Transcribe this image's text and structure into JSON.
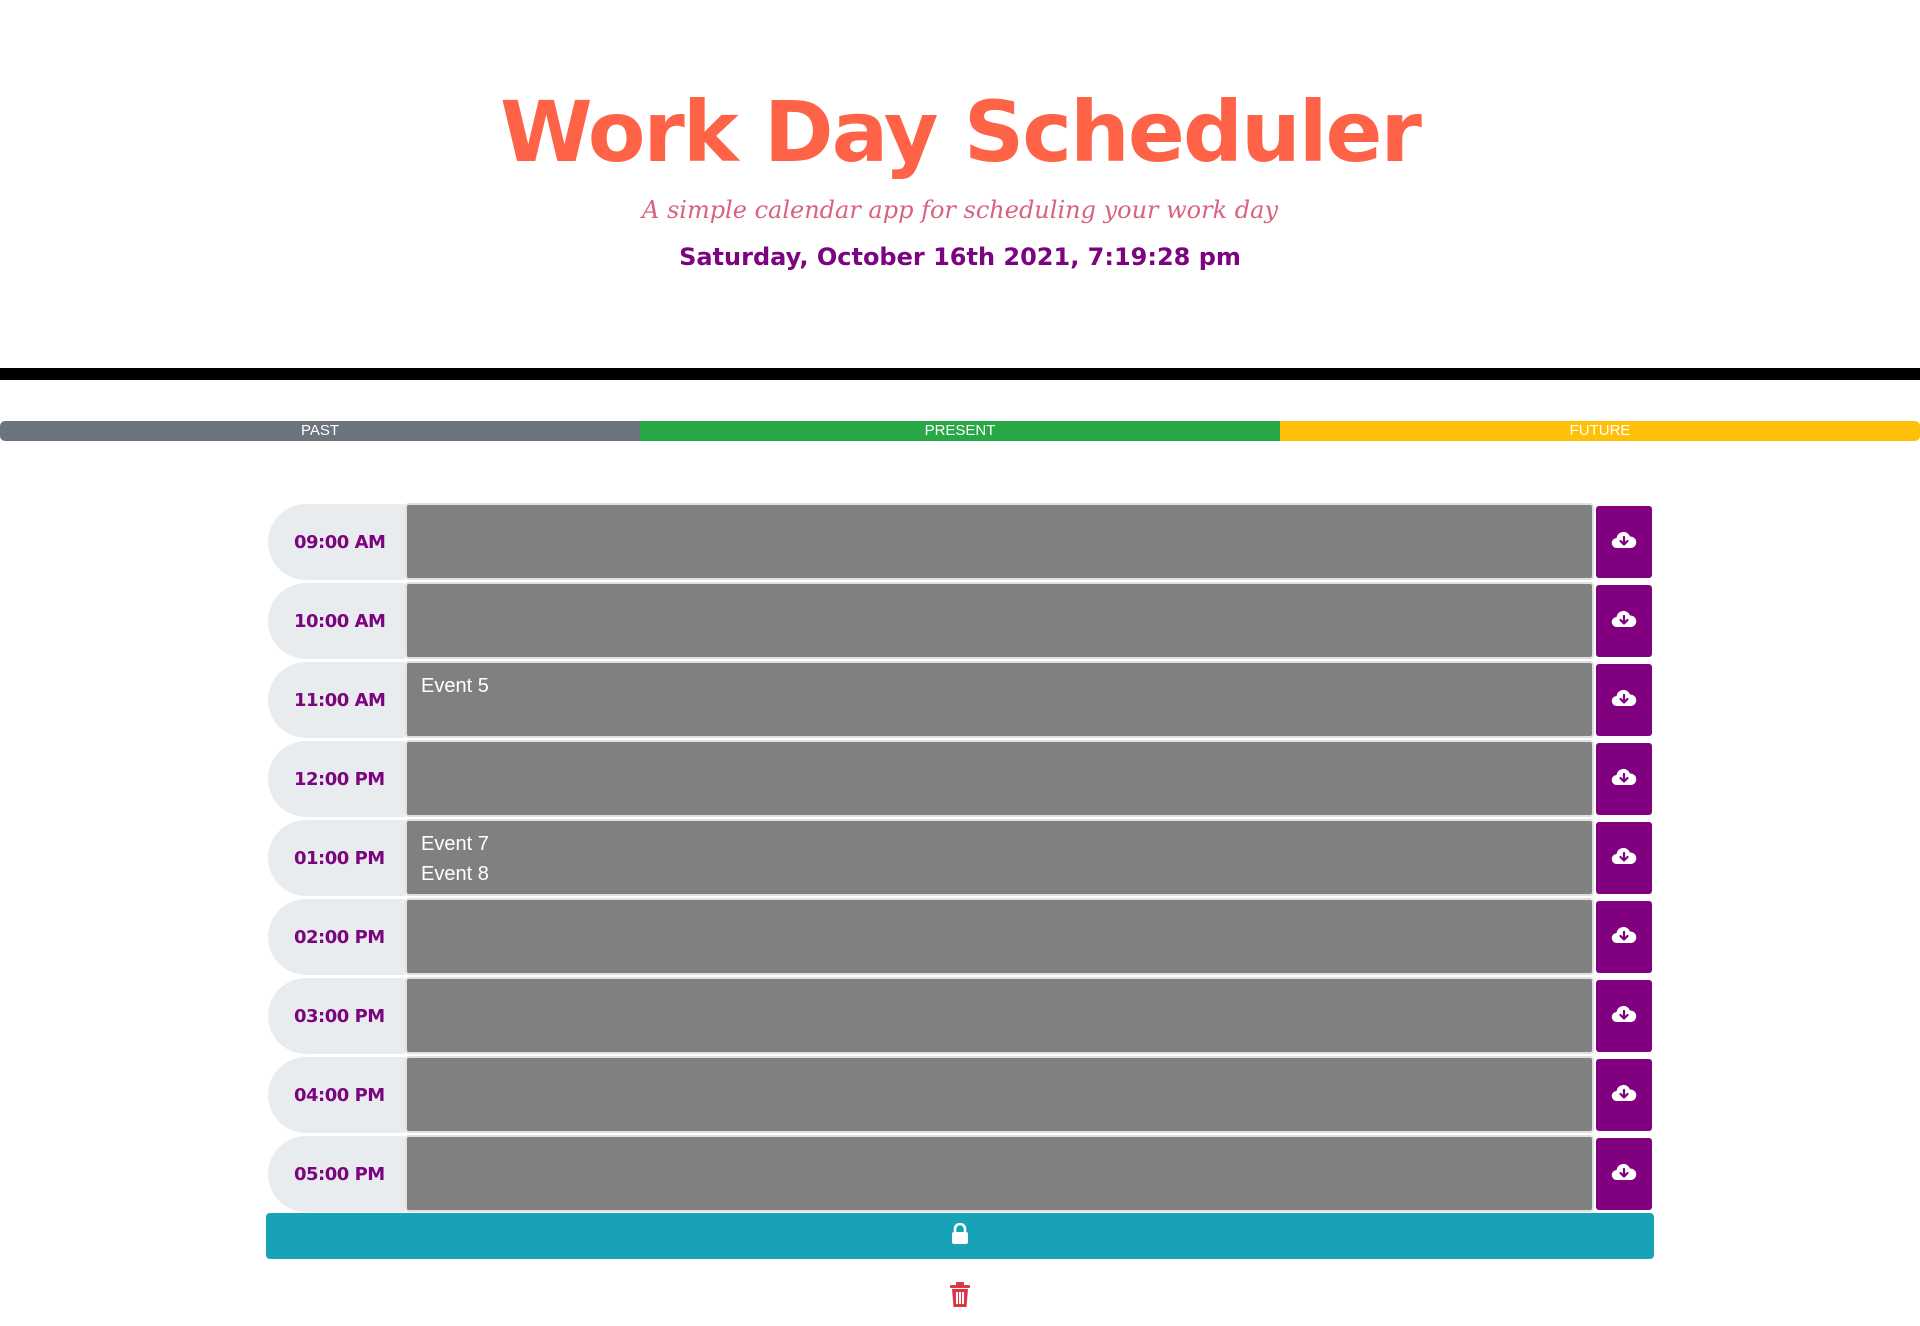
{
  "header": {
    "title": "Work Day Scheduler",
    "subtitle": "A simple calendar app for scheduling your work day",
    "datetime": "Saturday, October 16th 2021, 7:19:28 pm"
  },
  "legend": {
    "past": "PAST",
    "present": "PRESENT",
    "future": "FUTURE"
  },
  "schedule": {
    "rows": [
      {
        "hour": "09:00 AM",
        "events": []
      },
      {
        "hour": "10:00 AM",
        "events": []
      },
      {
        "hour": "11:00 AM",
        "events": [
          "Event 5"
        ]
      },
      {
        "hour": "12:00 PM",
        "events": []
      },
      {
        "hour": "01:00 PM",
        "events": [
          "Event 7",
          "Event 8"
        ]
      },
      {
        "hour": "02:00 PM",
        "events": []
      },
      {
        "hour": "03:00 PM",
        "events": []
      },
      {
        "hour": "04:00 PM",
        "events": []
      },
      {
        "hour": "05:00 PM",
        "events": []
      }
    ]
  },
  "icons": {
    "save": "cloud-download-icon",
    "lock": "lock-icon",
    "trash": "trash-icon"
  },
  "colors": {
    "title": "#ff6347",
    "accent": "#800080",
    "past": "#6c757d",
    "present": "#28a745",
    "future": "#ffc107",
    "lock_bar": "#17a2b8",
    "trash": "#dc3545"
  }
}
